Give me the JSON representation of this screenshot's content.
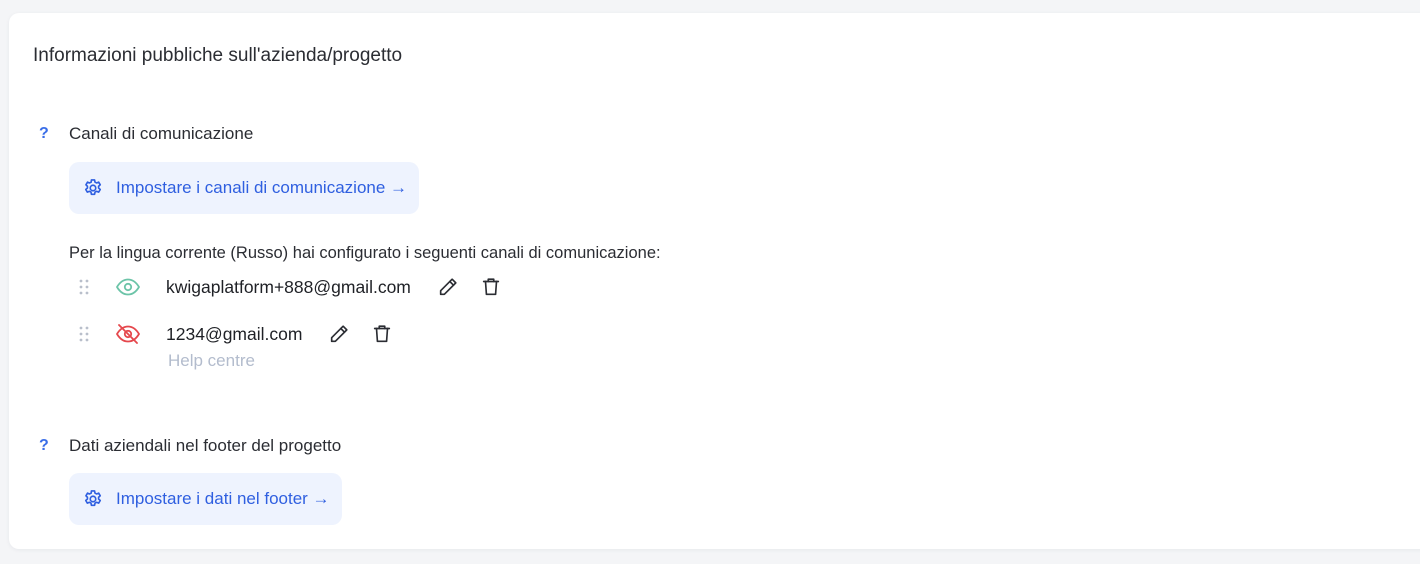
{
  "card": {
    "title": "Informazioni pubbliche sull'azienda/progetto"
  },
  "channels_section": {
    "help_mark": "?",
    "title": "Canali di comunicazione",
    "setup_button_label": "Impostare i canali di comunicazione →",
    "note": "Per la lingua corrente (Russo) hai configurato i seguenti canali di comunicazione:",
    "items": [
      {
        "value": "kwigaplatform+888@gmail.com",
        "visibility_icon": "eye-icon",
        "visible": true,
        "subtitle": ""
      },
      {
        "value": "1234@gmail.com",
        "visibility_icon": "eye-off-icon",
        "visible": false,
        "subtitle": "Help centre"
      }
    ]
  },
  "footer_section": {
    "help_mark": "?",
    "title": "Dati aziendali nel footer del progetto",
    "setup_button_label": "Impostare i dati nel footer →"
  },
  "icons": {
    "settings": "gear-icon",
    "drag": "drag-handle-icon",
    "edit": "pencil-icon",
    "delete": "trash-icon"
  },
  "colors": {
    "accent": "#2f5fe0",
    "button_bg": "#eef3fe",
    "visible_eye": "#6cc4a8",
    "hidden_eye": "#e5484d",
    "muted_text": "#b3bccd"
  }
}
